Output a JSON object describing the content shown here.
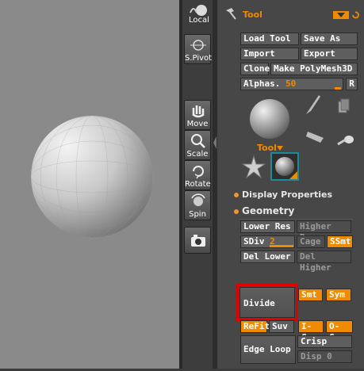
{
  "shelf": {
    "local_label": "Local",
    "spivot_label": "S.Pivot",
    "move_label": "Move",
    "scale_label": "Scale",
    "rotate_label": "Rotate",
    "spin_label": "Spin"
  },
  "tool_palette": {
    "title": "Tool",
    "buttons": {
      "load_tool": "Load Tool",
      "save_as": "Save As",
      "import": "Import",
      "export": "Export",
      "clone": "Clone",
      "make_polymesh": "Make PolyMesh3D"
    },
    "alphas_label": "Alphas.",
    "alphas_value": "50",
    "r_label": "R",
    "tool_dropdown": "Tool",
    "display_properties": "Display Properties",
    "geometry": "Geometry",
    "lower_res": "Lower Res",
    "higher_res": "Higher Res",
    "sdiv_label": "SDiv",
    "sdiv_value": "2",
    "cage": "Cage",
    "ssmt": "SSmt",
    "del_lower": "Del Lower",
    "del_higher": "Del Higher",
    "divide": "Divide",
    "smt": "Smt",
    "sym": "Sym",
    "refit": "ReFit",
    "suv": "Suv",
    "igrp": "I-Grp",
    "ogrp": "O-Grp",
    "edge_loop": "Edge Loop",
    "crisp": "Crisp",
    "disp": "Disp",
    "disp_value": "0"
  },
  "colors": {
    "accent": "#f08a00",
    "highlight_border": "#e00000",
    "canvas_bg": "#8a8a8a",
    "palette_bg": "#474747"
  }
}
